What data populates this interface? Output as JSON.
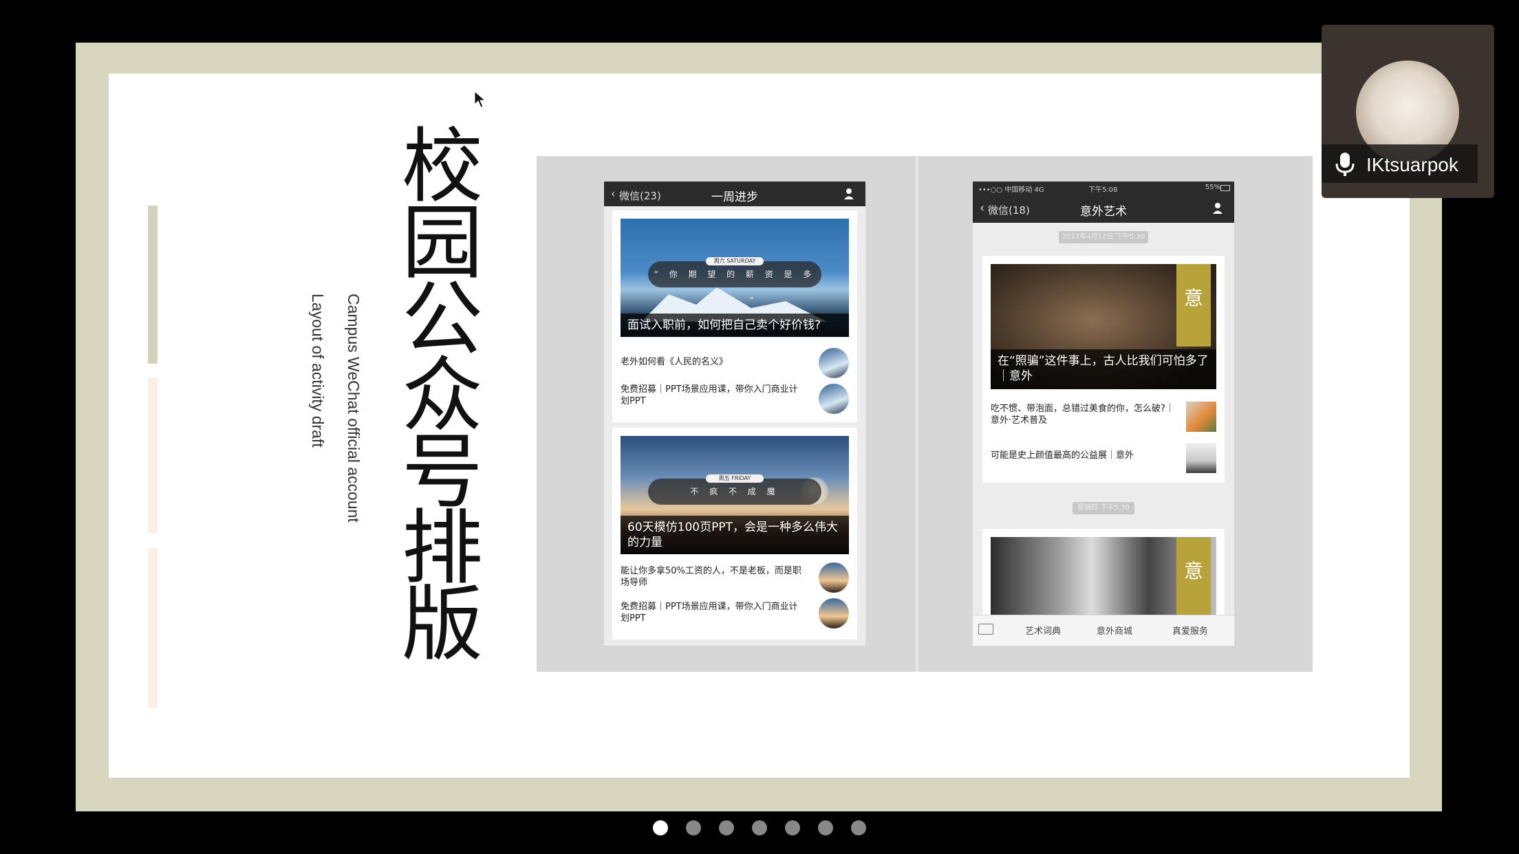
{
  "slide": {
    "title": "校园公众号 排版",
    "subtitle_en_1": "Campus WeChat official account",
    "subtitle_en_2": "Layout of activity draft"
  },
  "phone_left": {
    "back_label": "微信(23)",
    "title": "一周进步",
    "article1": {
      "pill_date": "周六 SATURDAY",
      "pill_text": "“ 你 期 望 的 薪 资 是 多 少 ？ ”",
      "caption": "面试入职前，如何把自己卖个好价钱?",
      "items": [
        "老外如何看《人民的名义》",
        "免费招募｜PPT场景应用课，带你入门商业计划PPT"
      ]
    },
    "article2": {
      "pill_date": "周五 FRIDAY",
      "pill_text": "不  疯  不  成  魔",
      "caption": "60天模仿100页PPT，会是一种多么伟大的力量",
      "items": [
        "能让你多拿50%工资的人，不是老板，而是职场导师",
        "免费招募｜PPT场景应用课，带你入门商业计划PPT"
      ]
    }
  },
  "phone_right": {
    "status_carrier": "•••○○ 中国移动  4G",
    "status_time": "下午5:08",
    "status_battery": "55%",
    "back_label": "微信(18)",
    "title": "意外艺术",
    "timestamp1": "2017年4月12日 下午5:30",
    "article1": {
      "tag": "意",
      "caption": "在“照骗”这件事上，古人比我们可怕多了｜意外",
      "items": [
        "吃不惯、带泡面，总错过美食的你，怎么破?｜意外·艺术普及",
        "可能是史上颜值最高的公益展｜意外"
      ]
    },
    "timestamp2": "星期四 下午5:30",
    "article2": {
      "tag": "意"
    },
    "menu": [
      "艺术词典",
      "意外商城",
      "真爱服务"
    ]
  },
  "participant": {
    "name": "IKtsuarpok"
  },
  "pagination": {
    "count": 7,
    "active": 0
  },
  "colors": {
    "frame": "#d9d6bf",
    "accent_gold": "#b8a23a",
    "deco_green": "#d4d2bb",
    "deco_peach": "#fbeee2"
  }
}
